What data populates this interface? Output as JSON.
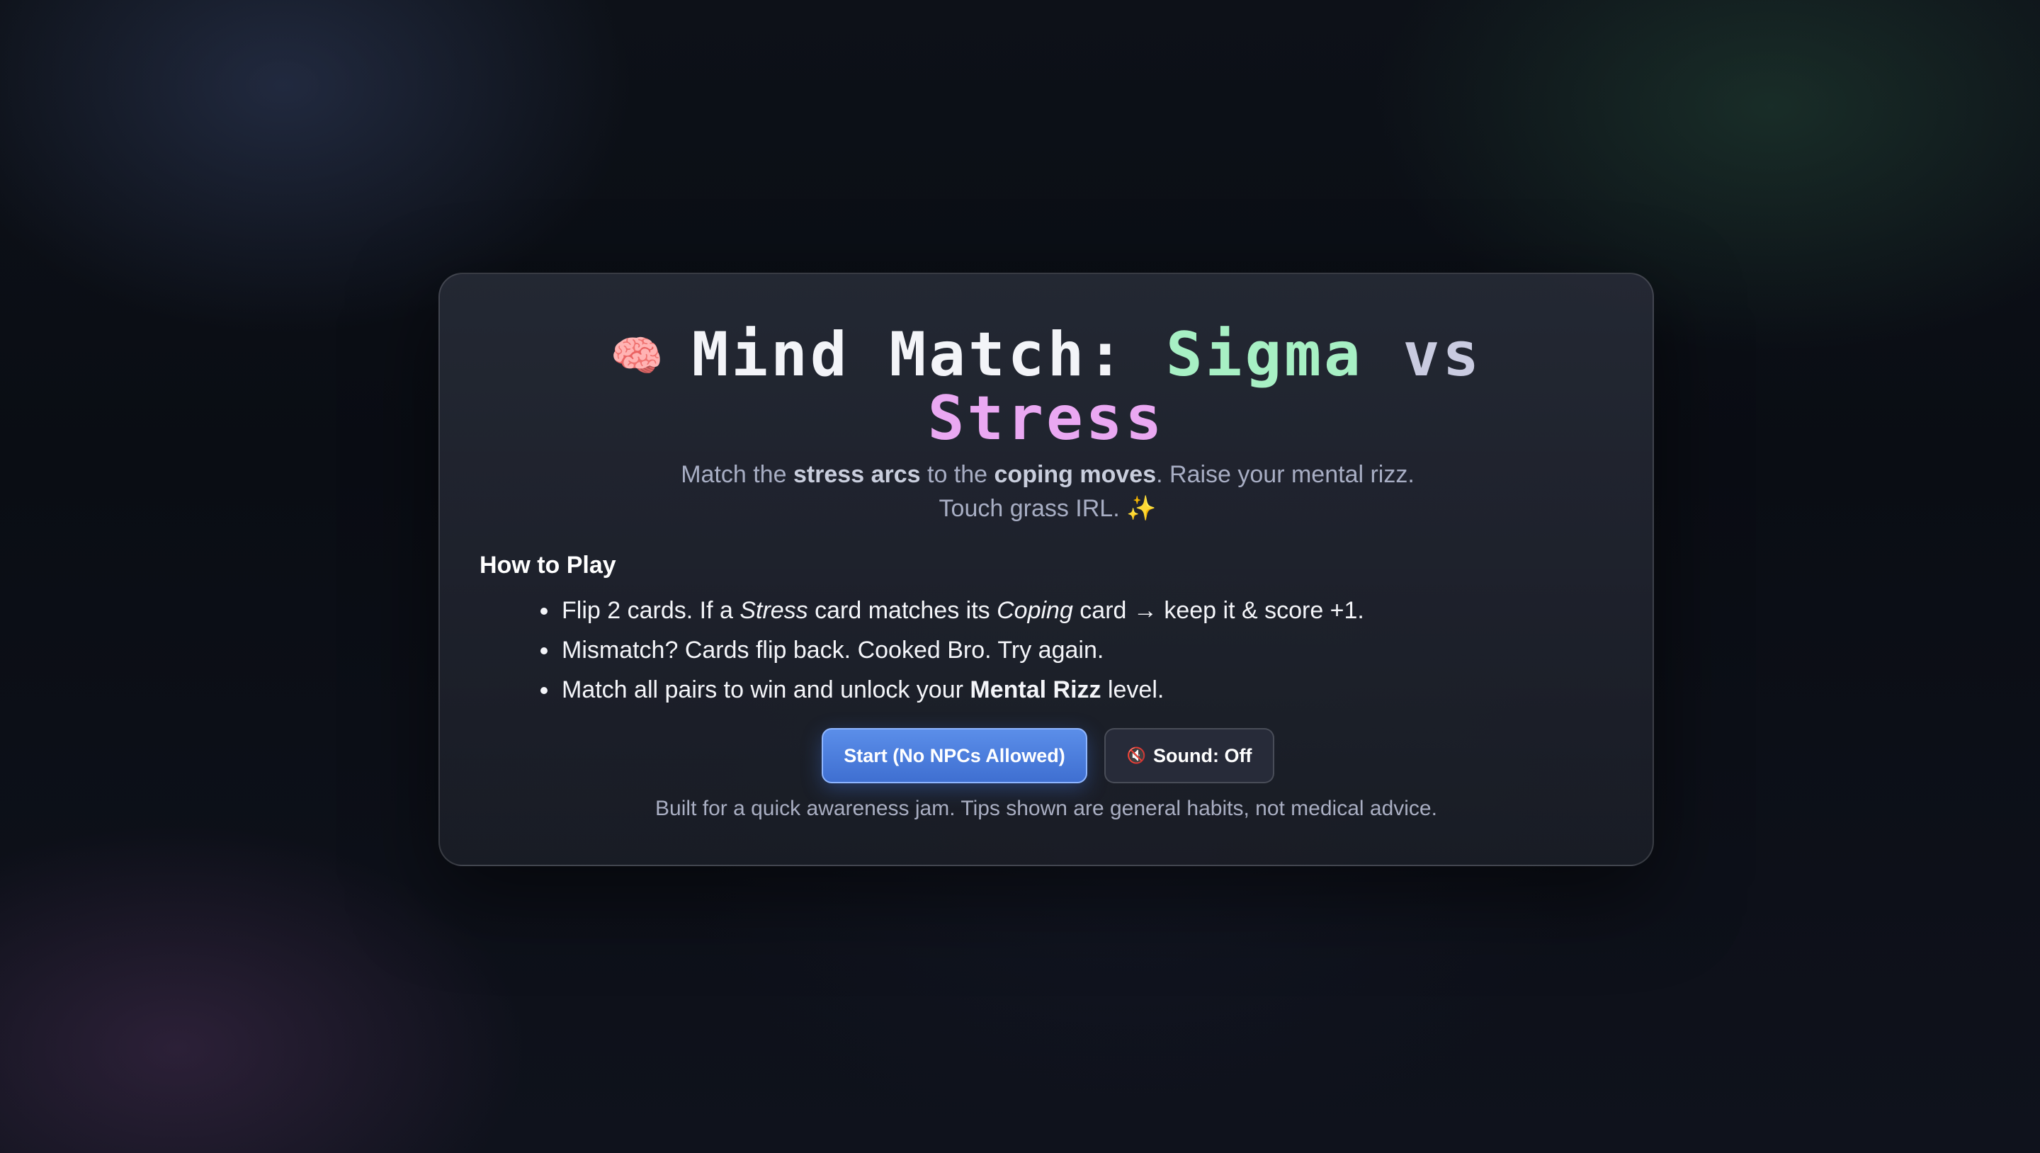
{
  "title": {
    "icon": "brain-icon",
    "part1": "Mind Match:",
    "part2": "Sigma",
    "part3": "vs",
    "part4": "Stress"
  },
  "subtitle": {
    "t1": "Match the ",
    "b1": "stress arcs",
    "t2": " to the ",
    "b2": "coping moves",
    "t3": ". Raise your mental rizz. Touch grass IRL. ✨"
  },
  "how_to_play": {
    "heading": "How to Play",
    "rule1": {
      "t1": "Flip 2 cards. If a ",
      "i1": "Stress",
      "t2": " card matches its ",
      "i2": "Coping",
      "t3": " card → keep it & score +1."
    },
    "rule2": "Mismatch? Cards flip back. Cooked Bro. Try again.",
    "rule3": {
      "t1": "Match all pairs to win and unlock your ",
      "b1": "Mental Rizz",
      "t2": " level."
    }
  },
  "buttons": {
    "start_label": "Start (No NPCs Allowed)",
    "sound_icon": "speaker-muted-icon",
    "sound_label": "Sound: Off"
  },
  "footer": "Built for a quick awareness jam. Tips shown are general habits, not medical advice.",
  "colors": {
    "title_white": "#f3f4f8",
    "sigma_green": "#a7f0c4",
    "stress_pink": "#eaa8f2",
    "start_button": "#4a7fe0"
  }
}
